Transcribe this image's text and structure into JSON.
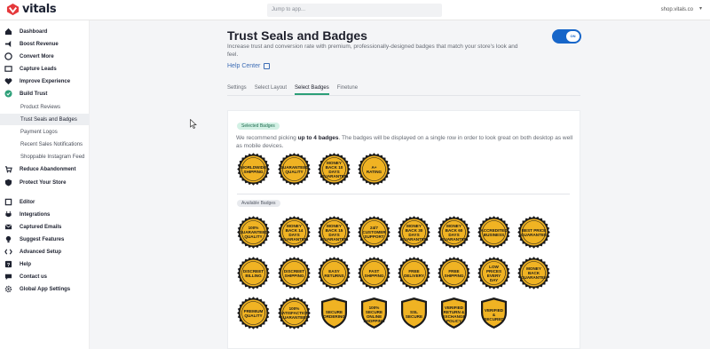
{
  "app": {
    "logo_text": "vitals",
    "search_placeholder": "Jump to app...",
    "shop_name": "shop.vitals.co",
    "shop_caret": "▾"
  },
  "sidebar": {
    "items": [
      {
        "label": "Dashboard",
        "icon": "home-icon"
      },
      {
        "label": "Boost Revenue",
        "icon": "megaphone-icon"
      },
      {
        "label": "Convert More",
        "icon": "chat-icon"
      },
      {
        "label": "Capture Leads",
        "icon": "folder-icon"
      },
      {
        "label": "Improve Experience",
        "icon": "heart-icon"
      },
      {
        "label": "Build Trust",
        "icon": "check-circle-icon"
      },
      {
        "label": "Reduce Abandonment",
        "icon": "cart-icon"
      },
      {
        "label": "Protect Your Store",
        "icon": "shield-icon"
      },
      {
        "label": "Editor",
        "icon": "pencil-icon"
      },
      {
        "label": "Integrations",
        "icon": "plug-icon"
      },
      {
        "label": "Captured Emails",
        "icon": "mail-icon"
      },
      {
        "label": "Suggest Features",
        "icon": "bulb-icon"
      },
      {
        "label": "Advanced Setup",
        "icon": "code-icon"
      },
      {
        "label": "Help",
        "icon": "help-icon"
      },
      {
        "label": "Contact us",
        "icon": "chat-bubble-icon"
      },
      {
        "label": "Global App Settings",
        "icon": "gear-icon"
      }
    ],
    "sub_items": [
      {
        "label": "Product Reviews"
      },
      {
        "label": "Trust Seals and Badges",
        "active": true
      },
      {
        "label": "Payment Logos"
      },
      {
        "label": "Recent Sales Notifications"
      },
      {
        "label": "Shoppable Instagram Feed"
      }
    ]
  },
  "page": {
    "title": "Trust Seals and Badges",
    "description": "Increase trust and conversion rate with premium, professionally-designed badges that match your store's look and feel.",
    "help_center": "Help Center",
    "toggle_label": "ON",
    "toggle_on": true
  },
  "tabs": [
    {
      "label": "Settings",
      "active": false
    },
    {
      "label": "Select Layout",
      "active": false
    },
    {
      "label": "Select Badges",
      "active": true
    },
    {
      "label": "Finetune",
      "active": false
    }
  ],
  "card": {
    "selected_pill": "Selected Badges",
    "recommend_pre": "We recommend picking ",
    "recommend_bold": "up to 4 badges",
    "recommend_post": ". The badges will be displayed on a single row in order to look great on both desktop as well as mobile devices.",
    "available_pill": "Available Badges",
    "badge_color": "#f0b323"
  },
  "selected_badges": [
    {
      "text": "WORLDWIDE SHIPPING",
      "shape": "seal"
    },
    {
      "text": "GUARANTEED QUALITY",
      "shape": "seal"
    },
    {
      "text": "MONEY BACK 10 DAYS GUARANTEE",
      "shape": "seal"
    },
    {
      "text": "A+ RATING",
      "shape": "seal"
    }
  ],
  "available_badges": [
    {
      "text": "100% GUARANTEED QUALITY",
      "shape": "seal"
    },
    {
      "text": "MONEY BACK 14 DAYS GUARANTEE",
      "shape": "seal"
    },
    {
      "text": "MONEY BACK 15 DAYS GUARANTEE",
      "shape": "seal"
    },
    {
      "text": "24/7 CUSTOMER SUPPORT",
      "shape": "seal"
    },
    {
      "text": "MONEY BACK 30 DAYS GUARANTEE",
      "shape": "seal"
    },
    {
      "text": "MONEY BACK 60 DAYS GUARANTEE",
      "shape": "seal"
    },
    {
      "text": "ACCREDITED BUSINESS",
      "shape": "seal"
    },
    {
      "text": "BEST PRICE GUARANTEE",
      "shape": "seal"
    },
    {
      "text": "DISCREET BILLING",
      "shape": "seal"
    },
    {
      "text": "DISCREET SHIPPING",
      "shape": "seal"
    },
    {
      "text": "EASY RETURNS",
      "shape": "seal"
    },
    {
      "text": "FAST SHIPPING",
      "shape": "seal"
    },
    {
      "text": "FREE DELIVERY",
      "shape": "seal"
    },
    {
      "text": "FREE SHIPPING",
      "shape": "seal"
    },
    {
      "text": "LOW PRICES EVERY DAY",
      "shape": "seal"
    },
    {
      "text": "MONEY BACK GUARANTEE",
      "shape": "seal"
    },
    {
      "text": "PREMIUM QUALITY",
      "shape": "seal"
    },
    {
      "text": "100% SATISFACTION GUARANTEED",
      "shape": "seal"
    },
    {
      "text": "SECURE ORDERING",
      "shape": "shield"
    },
    {
      "text": "100% SECURE ONLINE SHOPPING",
      "shape": "shield"
    },
    {
      "text": "SSL SECURE",
      "shape": "shield"
    },
    {
      "text": "VERIFIED RETURN & EXCHANGE POLICY",
      "shape": "shield"
    },
    {
      "text": "VERIFIED & SECURED",
      "shape": "shield"
    }
  ]
}
